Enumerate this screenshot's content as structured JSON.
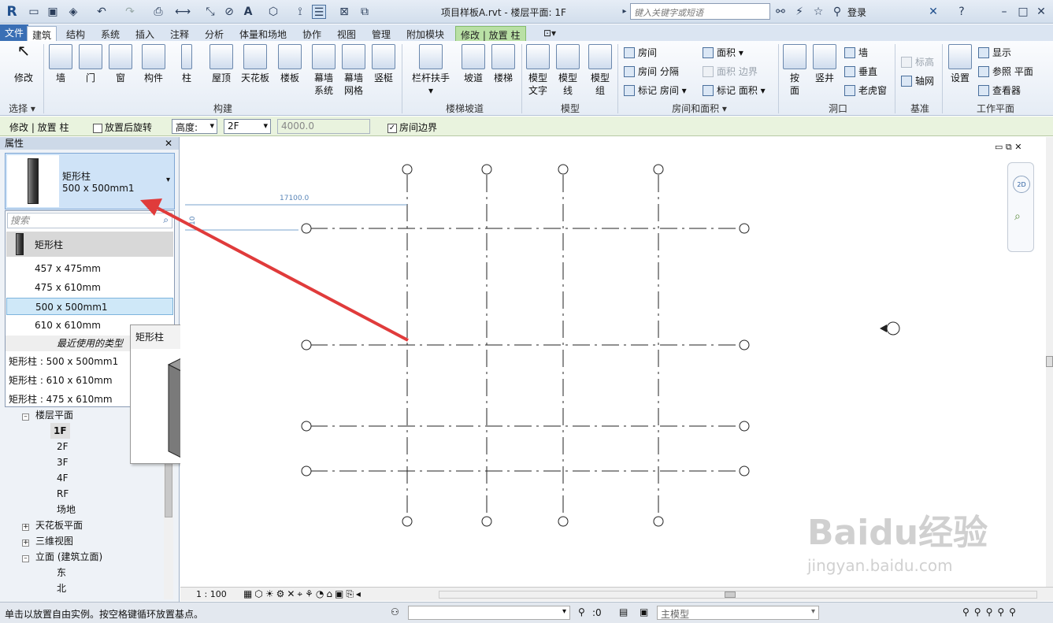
{
  "app": {
    "logo": "R",
    "title": "项目样板A.rvt - 楼层平面: 1F",
    "search_placeholder": "键入关键字或短语",
    "login": "登录"
  },
  "tabs": [
    "文件",
    "建筑",
    "结构",
    "系统",
    "插入",
    "注释",
    "分析",
    "体量和场地",
    "协作",
    "视图",
    "管理",
    "附加模块",
    "修改 | 放置 柱"
  ],
  "ribbon": {
    "select": {
      "label": "选择",
      "button": "修改"
    },
    "build": {
      "label": "构建",
      "buttons": [
        "墙",
        "门",
        "窗",
        "构件",
        "柱",
        "屋顶",
        "天花板",
        "楼板",
        "幕墙\n系统",
        "幕墙\n网格",
        "竖梃"
      ]
    },
    "stairs": {
      "label": "楼梯坡道",
      "buttons": [
        "栏杆扶手",
        "坡道",
        "楼梯"
      ]
    },
    "model": {
      "label": "模型",
      "buttons": [
        "模型\n文字",
        "模型\n线",
        "模型\n组"
      ]
    },
    "room": {
      "label": "房间和面积",
      "items": [
        "房间",
        "房间 分隔",
        "标记 房间",
        "面积",
        "面积 边界",
        "标记 面积"
      ]
    },
    "opening": {
      "label": "洞口",
      "buttons": [
        "按\n面",
        "竖井"
      ],
      "items": [
        "墙",
        "垂直",
        "老虎窗"
      ]
    },
    "datum": {
      "label": "基准",
      "items": [
        "标高",
        "轴网"
      ]
    },
    "workplane": {
      "label": "工作平面",
      "button": "设置",
      "items": [
        "显示",
        "参照 平面",
        "查看器"
      ]
    }
  },
  "options_bar": {
    "context": "修改 | 放置 柱",
    "rotate_after_place": "放置后旋转",
    "height_label": "高度:",
    "level": "2F",
    "height_value": "4000.0",
    "room_bounding": "房间边界"
  },
  "properties": {
    "title": "属性",
    "family": "矩形柱",
    "type": "500 x 500mm1",
    "search_placeholder": "搜索",
    "dropdown": {
      "family_header": "矩形柱",
      "types": [
        "457 x 475mm",
        "475 x 610mm",
        "500 x 500mm1",
        "610 x 610mm"
      ],
      "selected_index": 2,
      "recent_header": "最近使用的类型",
      "recent": [
        "矩形柱 : 500 x 500mm1",
        "矩形柱 : 610 x 610mm",
        "矩形柱 : 475 x 610mm"
      ]
    }
  },
  "tooltip": {
    "title": "矩形柱"
  },
  "project_browser": {
    "floor_plans": "楼层平面",
    "levels": [
      "1F",
      "2F",
      "3F",
      "4F",
      "RF",
      "场地"
    ],
    "ceiling_plans": "天花板平面",
    "views_3d": "三维视图",
    "elevations": "立面 (建筑立面)",
    "elevation_views": [
      "东",
      "北"
    ]
  },
  "canvas": {
    "dimension": "17100.0",
    "dimension_small": "10"
  },
  "view_bar": {
    "scale": "1 : 100"
  },
  "status": {
    "message": "单击以放置自由实例。按空格键循环放置基点。",
    "selection_count": ":0",
    "model": "主模型"
  },
  "watermark": {
    "brand": "Baidu经验",
    "url": "jingyan.baidu.com"
  },
  "colors": {
    "accent": "#3a6fb5",
    "context_tab": "#b9e0a5",
    "arrow": "#e03b3b",
    "selection": "#cfe8f8"
  }
}
